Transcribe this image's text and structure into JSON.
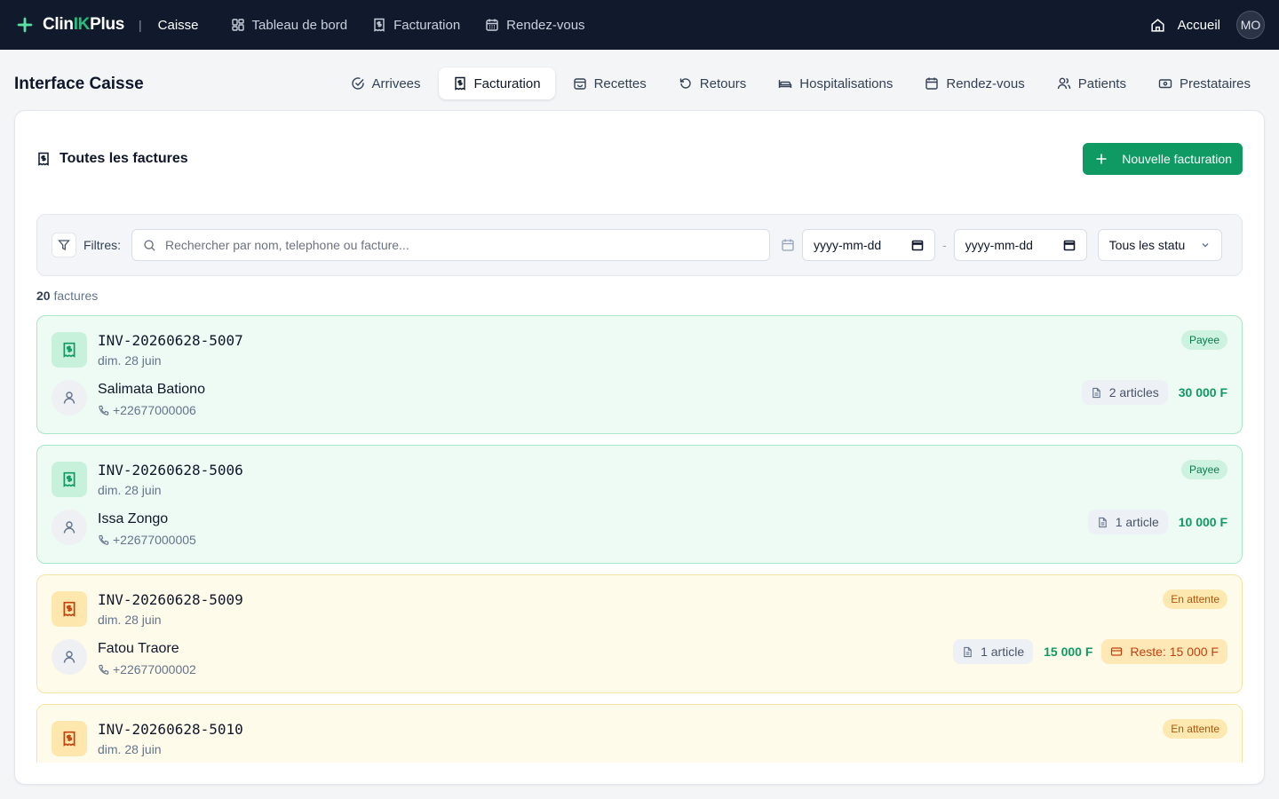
{
  "topbar": {
    "brand_prefix": "Clin",
    "brand_k": "IK",
    "brand_suffix": "Plus",
    "separator": "|",
    "section": "Caisse",
    "nav": [
      {
        "label": "Tableau de bord",
        "icon": "dashboard-icon"
      },
      {
        "label": "Facturation",
        "icon": "invoice-icon"
      },
      {
        "label": "Rendez-vous",
        "icon": "calendar-icon"
      }
    ],
    "home_label": "Accueil",
    "avatar_initials": "MO"
  },
  "header": {
    "title": "Interface Caisse",
    "tabs": [
      {
        "label": "Arrivees",
        "icon": "check-circle-icon"
      },
      {
        "label": "Facturation",
        "icon": "invoice-icon",
        "active": true
      },
      {
        "label": "Recettes",
        "icon": "wallet-icon"
      },
      {
        "label": "Retours",
        "icon": "undo-icon"
      },
      {
        "label": "Hospitalisations",
        "icon": "bed-icon"
      },
      {
        "label": "Rendez-vous",
        "icon": "calendar-icon"
      },
      {
        "label": "Patients",
        "icon": "users-icon"
      },
      {
        "label": "Prestataires",
        "icon": "banknote-icon"
      }
    ]
  },
  "card": {
    "title": "Toutes les factures",
    "new_button": "Nouvelle facturation"
  },
  "filters": {
    "label": "Filtres:",
    "search_placeholder": "Rechercher par nom, telephone ou facture...",
    "date_from": "yyyy-mm-dd",
    "date_separator": "-",
    "date_to": "yyyy-mm-dd",
    "status_value": "Tous les statu"
  },
  "count": {
    "number": "20",
    "label": "factures"
  },
  "invoices": [
    {
      "id": "INV-20260628-5007",
      "date": "dim. 28 juin",
      "status": "Payee",
      "name": "Salimata Bationo",
      "phone": "+22677000006",
      "articles": "2 articles",
      "amount": "30 000 F",
      "remaining": ""
    },
    {
      "id": "INV-20260628-5006",
      "date": "dim. 28 juin",
      "status": "Payee",
      "name": "Issa Zongo",
      "phone": "+22677000005",
      "articles": "1 article",
      "amount": "10 000 F",
      "remaining": ""
    },
    {
      "id": "INV-20260628-5009",
      "date": "dim. 28 juin",
      "status": "En attente",
      "name": "Fatou Traore",
      "phone": "+22677000002",
      "articles": "1 article",
      "amount": "15 000 F",
      "remaining": "Reste: 15 000 F"
    },
    {
      "id": "INV-20260628-5010",
      "date": "dim. 28 juin",
      "status": "En attente",
      "name": "",
      "phone": "",
      "articles": "",
      "amount": "",
      "remaining": ""
    }
  ],
  "colors": {
    "topbar_bg": "#111a2c",
    "brand_accent": "#22c07a",
    "primary_button": "#0e9a62",
    "paid_bg": "#eefbf4",
    "pending_bg": "#fffbea"
  }
}
